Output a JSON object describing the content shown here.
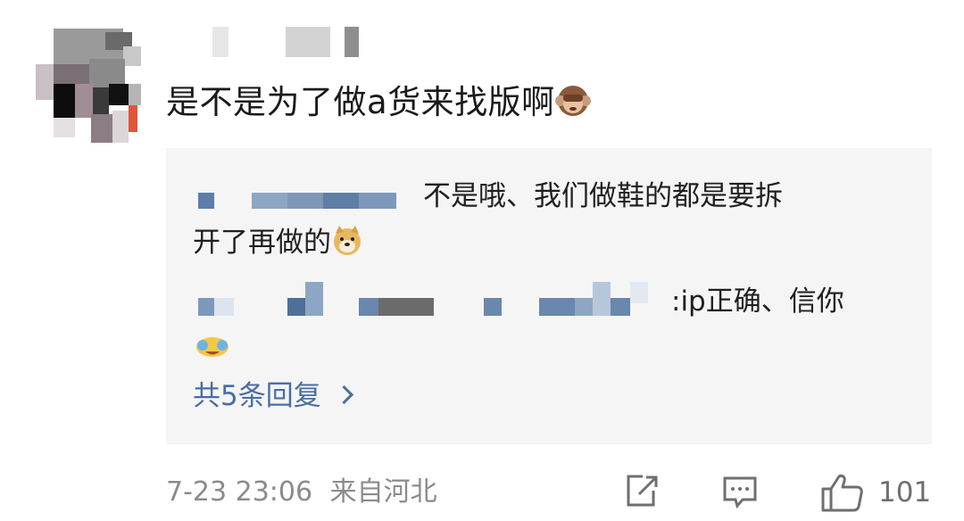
{
  "comment": {
    "text": "是不是为了做a货来找版啊",
    "emoji_name": "see-no-evil-monkey-icon"
  },
  "replies": [
    {
      "text_line1": "不是哦、我们做鞋的都是要拆",
      "text_line2": "开了再做的",
      "emoji_name": "doge-icon"
    },
    {
      "text": ":ip正确、信你",
      "emoji_name": "laughing-emoji-icon"
    }
  ],
  "more_replies_label": "共5条回复",
  "footer": {
    "timestamp": "7-23 23:06",
    "location": "来自河北",
    "like_count": "101"
  },
  "icons": {
    "share": "share-icon",
    "comment": "comment-icon",
    "like": "thumbs-up-icon"
  },
  "colors": {
    "link": "#4a6ea3",
    "reply_bg": "#f5f5f5",
    "meta_text": "#8b8b8b"
  }
}
